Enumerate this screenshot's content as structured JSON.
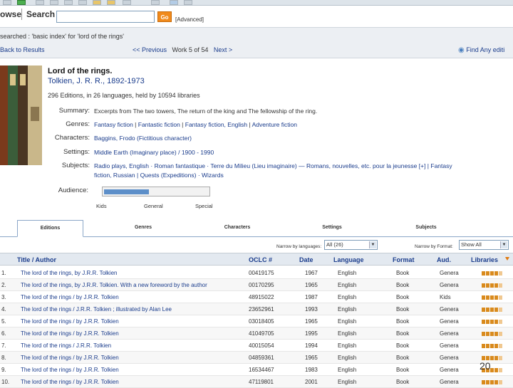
{
  "search": {
    "browse_label": "owse",
    "search_label": "Search",
    "input_value": "",
    "go_label": "Go",
    "advanced_label": "[Advanced]"
  },
  "infobar": {
    "searched_text": "searched :   'basic index' for 'lord of the rings'",
    "back_label": "Back to Results",
    "prev_label": "<< Previous",
    "position_text": "Work 5 of 54",
    "next_label": "Next >",
    "find_any_label": "Find Any editi"
  },
  "record": {
    "title": "Lord of the rings.",
    "author": "Tolkien, J. R. R., 1892-1973",
    "editions_summary": "296 Editions, in 26 languages, held by 10594 libraries",
    "labels": {
      "summary": "Summary:",
      "genres": "Genres:",
      "characters": "Characters:",
      "settings": "Settings:",
      "subjects": "Subjects:",
      "audience": "Audience:"
    },
    "summary": "Excerpts from The two towers, The return of the king and The fellowship of the ring.",
    "genres": [
      "Fantasy fiction",
      "Fantastic fiction",
      "Fantasy fiction, English",
      "Adventure fiction"
    ],
    "characters": "Baggins, Frodo (Fictitious character)",
    "settings": "Middle Earth (Imaginary place) / 1900 - 1990",
    "subjects_line1": "Radio plays, English  · Roman fantastique · Terre du Milieu (Lieu imaginaire) — Romans, nouvelles, etc. pour la jeunesse [+] | Fantasy",
    "subjects_line2": "fiction, Russian | Quests (Expeditions) · Wizards",
    "audience_level": 0.43,
    "audience_scale": [
      "Kids",
      "General",
      "Special"
    ]
  },
  "tabs": [
    "Editions",
    "Genres",
    "Characters",
    "Settings",
    "Subjects"
  ],
  "filters": {
    "language_label": "Narrow by languages:",
    "language_value": "All (26)",
    "format_label": "Narrow by Format:",
    "format_value": "Show All"
  },
  "table": {
    "headers": [
      "Title / Author",
      "OCLC #",
      "Date",
      "Language",
      "Format",
      "Aud.",
      "Libraries"
    ],
    "rows": [
      {
        "n": "1.",
        "title": "The lord of the rings, by J.R.R. Tolkien",
        "oclc": "00419175",
        "date": "1967",
        "lang": "English",
        "format": "Book",
        "aud": "Genera",
        "libs": 4
      },
      {
        "n": "2.",
        "title": "The lord of the rings, by J.R.R. Tolkien. With a new foreword by the author",
        "oclc": "00170295",
        "date": "1965",
        "lang": "English",
        "format": "Book",
        "aud": "Genera",
        "libs": 4
      },
      {
        "n": "3.",
        "title": "The lord of the rings / by J.R.R. Tolkien",
        "oclc": "48915022",
        "date": "1987",
        "lang": "English",
        "format": "Book",
        "aud": "Kids",
        "libs": 4
      },
      {
        "n": "4.",
        "title": "The lord of the rings / J.R.R. Tolkien ; illustrated by Alan Lee",
        "oclc": "23652961",
        "date": "1993",
        "lang": "English",
        "format": "Book",
        "aud": "Genera",
        "libs": 4
      },
      {
        "n": "5.",
        "title": "The lord of the rings / by J.R.R. Tolkien",
        "oclc": "03018405",
        "date": "1965",
        "lang": "English",
        "format": "Book",
        "aud": "Genera",
        "libs": 4
      },
      {
        "n": "6.",
        "title": "The lord of the rings / by J.R.R. Tolkien",
        "oclc": "41049705",
        "date": "1995",
        "lang": "English",
        "format": "Book",
        "aud": "Genera",
        "libs": 4
      },
      {
        "n": "7.",
        "title": "The lord of the rings / J.R.R. Tolkien",
        "oclc": "40015054",
        "date": "1994",
        "lang": "English",
        "format": "Book",
        "aud": "Genera",
        "libs": 4
      },
      {
        "n": "8.",
        "title": "The lord of the rings / by J.R.R. Tolkien",
        "oclc": "04859361",
        "date": "1965",
        "lang": "English",
        "format": "Book",
        "aud": "Genera",
        "libs": 4
      },
      {
        "n": "9.",
        "title": "The lord of the rings / by J.R.R. Tolkien",
        "oclc": "16534467",
        "date": "1983",
        "lang": "English",
        "format": "Book",
        "aud": "Genera",
        "libs": 4
      },
      {
        "n": "10.",
        "title": "The lord of the rings / by J.R.R. Tolkien",
        "oclc": "47119801",
        "date": "2001",
        "lang": "English",
        "format": "Book",
        "aud": "Genera",
        "libs": 4
      }
    ]
  },
  "page_number": "20"
}
